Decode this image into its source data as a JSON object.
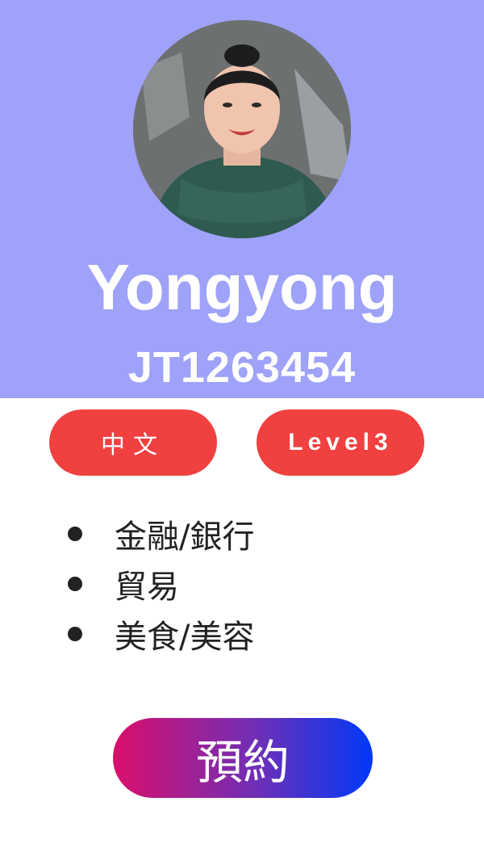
{
  "profile": {
    "avatar_icon": "person-photo-icon",
    "name": "Yongyong",
    "code": "JT1263454"
  },
  "badges": {
    "language": "中文",
    "level": "Level3"
  },
  "categories": [
    "金融/銀行",
    "貿易",
    "美食/美容"
  ],
  "actions": {
    "book_label": "預約"
  },
  "colors": {
    "header_bg": "#9ea2f9",
    "badge_bg": "#f04040",
    "button_gradient_start": "#da0f6b",
    "button_gradient_end": "#0039f7"
  }
}
